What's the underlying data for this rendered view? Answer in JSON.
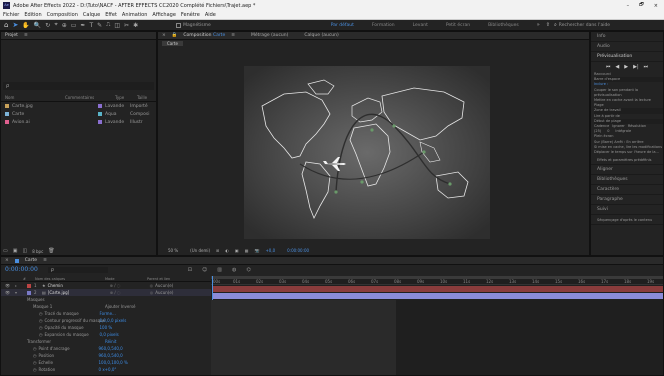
{
  "window": {
    "title": "Adobe After Effects 2022 - D:\\Tuto\\NACF - AFTER EFFECTS CC2020 Complété Fichiers\\Trajet.aep *",
    "min": "–",
    "max": "🗗",
    "close": "×"
  },
  "menu": [
    "Fichier",
    "Edition",
    "Composition",
    "Calque",
    "Effet",
    "Animation",
    "Affichage",
    "Fenêtre",
    "Aide"
  ],
  "toolbar": {
    "snap_label": "Magnétisme",
    "workspaces": [
      "Par défaut",
      "Formation",
      "Levant",
      "Petit écran",
      "Bibliothèques"
    ],
    "search_placeholder": "Rechercher dans l'aide"
  },
  "project": {
    "tab": "Projet",
    "search_placeholder": "ρ",
    "columns": [
      "Nom",
      "Commentaires",
      "Type",
      "Taille"
    ],
    "items": [
      {
        "name": "Carte.jpg",
        "color": "#c9a25a",
        "label": "Lavande",
        "type": "Importé",
        "sq": "#8a6fd0"
      },
      {
        "name": "Carte",
        "color": "#7db4d8",
        "label": "Aqua",
        "type": "Composi",
        "sq": "#5ab4c8"
      },
      {
        "name": "Avion.ai",
        "color": "#e06090",
        "label": "Lavande",
        "type": "Illustr",
        "sq": "#8a6fd0"
      }
    ],
    "bpc": "8 bpc"
  },
  "composition": {
    "tab": "Composition",
    "tab_name": "Carte",
    "tab2": "Métrage (aucun)",
    "tab3": "Calque (aucun)",
    "breadcrumb": "Carte",
    "zoom": "50 %",
    "res": "(Un demi)",
    "exposure": "+0,0",
    "timecode": "0:00:00:00"
  },
  "right_panel": {
    "items_top": [
      "Info",
      "Audio",
      "Prévisualisation"
    ],
    "preview_controls": [
      "⏮",
      "◀",
      "▶",
      "▶|",
      "⏭"
    ],
    "raccourci": "Raccourci",
    "raccourci_val": "Barre d'espace",
    "inclure": "Inclure :",
    "mute": "Couper le son pendant la prévisualisation",
    "cache": "Mettre en cache avant la lecture",
    "plage": "Plage",
    "plage_val": "Zone de travail",
    "lire_depuis": "Lire à partir de",
    "lire_val": "Début de plage",
    "cadence": "Cadence",
    "ignorer": "Ignorer",
    "resolution": "Résolution",
    "cadence_val": "(25)",
    "ignorer_val": "0",
    "res_val": "Intégrale",
    "plein_ecran": "Plein écran",
    "stop": "Sur (Barre) Arrêt : En arrière",
    "stop_opt1": "Si mise en cache, lire les modifications",
    "stop_opt2": "Déplacer le temps sur l'heure de la...",
    "effets": "Effets et paramètres prédéfinis",
    "aligner": "Aligner",
    "bibliotheques": "Bibliothèques",
    "caractere": "Caractère",
    "paragraphe": "Paragraphe",
    "suivi": "Suivi",
    "sequencage": "Séquençage d'après le contenu"
  },
  "timeline": {
    "tab": "Carte",
    "timecode": "0:00:00:00",
    "search_placeholder": "ρ",
    "columns": [
      "#",
      "Nom des calques",
      "Mode",
      "Parent et lien"
    ],
    "ruler": [
      "00s",
      "01s",
      "02s",
      "03s",
      "04s",
      "05s",
      "06s",
      "07s",
      "08s",
      "09s",
      "10s",
      "11s",
      "12s",
      "13s",
      "14s",
      "15s",
      "16s",
      "17s",
      "18s",
      "19s"
    ],
    "layers": [
      {
        "num": "1",
        "name": "Chemin",
        "parent": "Aucun(e)",
        "color": "#b44",
        "bar": "#c64c4c"
      },
      {
        "num": "2",
        "name": "[Carte.jpg]",
        "parent": "Aucun(e)",
        "color": "#7a7ac8",
        "bar": "#8a8ad8"
      }
    ],
    "props": [
      {
        "label": "Masques",
        "val": "",
        "indent": 0
      },
      {
        "label": "Masque 1",
        "val": "Ajouter  Inversé",
        "indent": 1
      },
      {
        "label": "Tracé du masque",
        "val": "Forme...",
        "indent": 2
      },
      {
        "label": "Contour progressif du masque",
        "val": "0,0,0,0 pixels",
        "indent": 2
      },
      {
        "label": "Opacité du masque",
        "val": "100 %",
        "indent": 2
      },
      {
        "label": "Expansion du masque",
        "val": "0,0 pixels",
        "indent": 2
      },
      {
        "label": "Transformer",
        "val": "Réinit",
        "indent": 0
      },
      {
        "label": "Point d'ancrage",
        "val": "960,0,540,0",
        "indent": 1
      },
      {
        "label": "Position",
        "val": "960,0,540,0",
        "indent": 1
      },
      {
        "label": "Echelle",
        "val": "100,0,100,0 %",
        "indent": 1
      },
      {
        "label": "Rotation",
        "val": "0 x+0,0°",
        "indent": 1
      }
    ]
  }
}
